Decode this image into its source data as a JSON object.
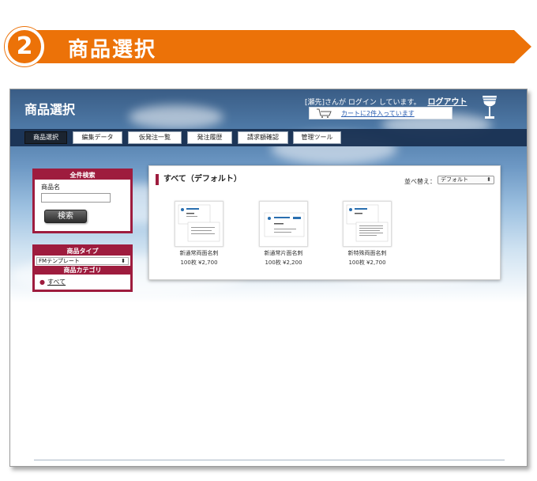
{
  "banner": {
    "number": "2",
    "title": "商品選択"
  },
  "header": {
    "app_title": "商品選択",
    "user_text": "[瀬先]さんが ログイン しています。",
    "logout_label": "ログアウト",
    "cart_label": "カートに2件入っています"
  },
  "nav": {
    "tabs": [
      {
        "label": "商品選択",
        "active": true
      },
      {
        "label": "編集データ"
      },
      {
        "label": "仮発注一覧"
      },
      {
        "label": "発注履歴"
      },
      {
        "label": "請求額確認"
      },
      {
        "label": "管理ツール"
      }
    ]
  },
  "search_panel": {
    "heading": "全件検索",
    "field_label": "商品名",
    "field_value": "",
    "button_label": "検索"
  },
  "type_panel": {
    "type_heading": "商品タイプ",
    "type_selected": "FMテンプレート",
    "category_heading": "商品カテゴリ",
    "category_link": "すべて"
  },
  "products": {
    "heading": "すべて（デフォルト）",
    "sort_label": "並べ替え：",
    "sort_selected": "デフォルト",
    "items": [
      {
        "name": "新通常両面名刺",
        "price": "100枚 ¥2,700"
      },
      {
        "name": "新通常片面名刺",
        "price": "100枚 ¥2,200"
      },
      {
        "name": "新特殊両面名刺",
        "price": "100枚 ¥2,700"
      }
    ]
  },
  "colors": {
    "banner": "#ec7208",
    "accent": "#9e1c3e",
    "nav": "#1a3253"
  }
}
